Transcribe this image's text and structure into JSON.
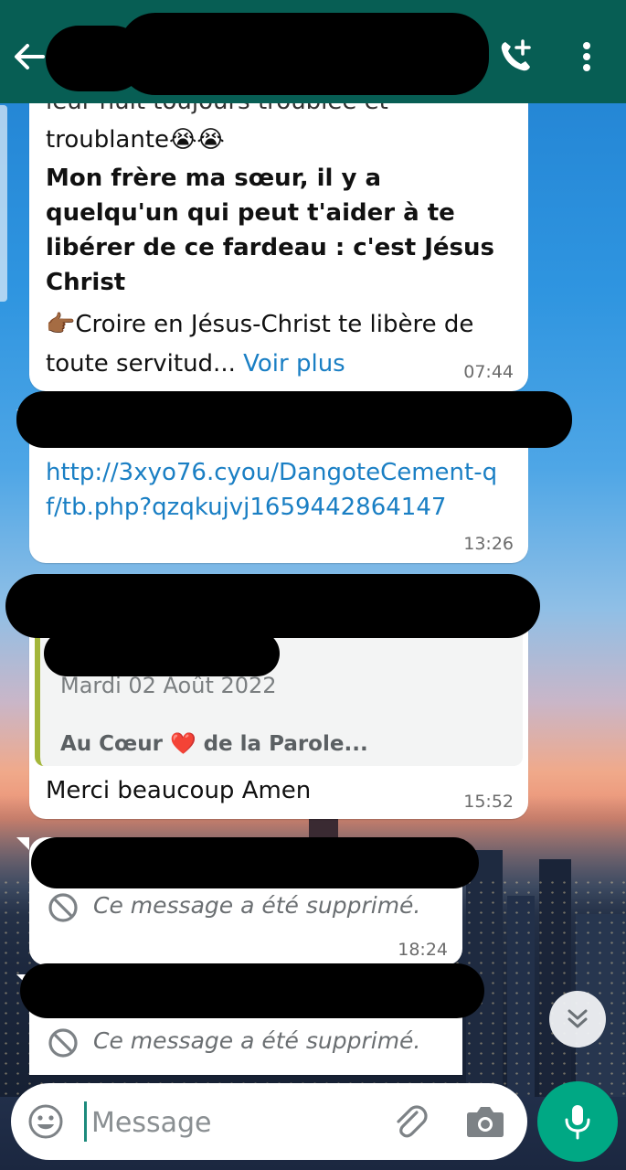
{
  "header": {
    "back_icon": "arrow-left-icon",
    "call_icon": "add-call-icon",
    "menu_icon": "more-vertical-icon"
  },
  "messages": [
    {
      "partial_line": "leur nuit toujours troublée et",
      "line_troublante": "troublante😭😭",
      "bold_text": "Mon frère ma sœur, il y a quelqu'un qui peut t'aider à te libérer de ce fardeau : c'est Jésus Christ",
      "body_prefix": "👉🏾Croire en Jésus-Christ te libère de toute servitud...",
      "more_label": "Voir plus",
      "time": "07:44"
    },
    {
      "link": "http://3xyo76.cyou/DangoteCement-qf/tb.php?qzqkujvj1659442864147",
      "time": "13:26"
    },
    {
      "quote_date": "Mardi 02 Août 2022",
      "quote_text": "Au Cœur ❤️ de la Parole...",
      "text": "Merci beaucoup Amen",
      "time": "15:52"
    },
    {
      "deleted_text": "Ce message a été supprimé.",
      "time": "18:24"
    },
    {
      "deleted_text": "Ce message a été supprimé."
    }
  ],
  "composer": {
    "placeholder": "Message",
    "emoji_icon": "emoji-icon",
    "attach_icon": "paperclip-icon",
    "camera_icon": "camera-icon",
    "mic_icon": "microphone-icon"
  },
  "scroll_down_icon": "double-chevron-down-icon",
  "colors": {
    "header": "#075e54",
    "accent": "#00a884",
    "link": "#1a7fc4",
    "quote_bar": "#a4b63a"
  }
}
